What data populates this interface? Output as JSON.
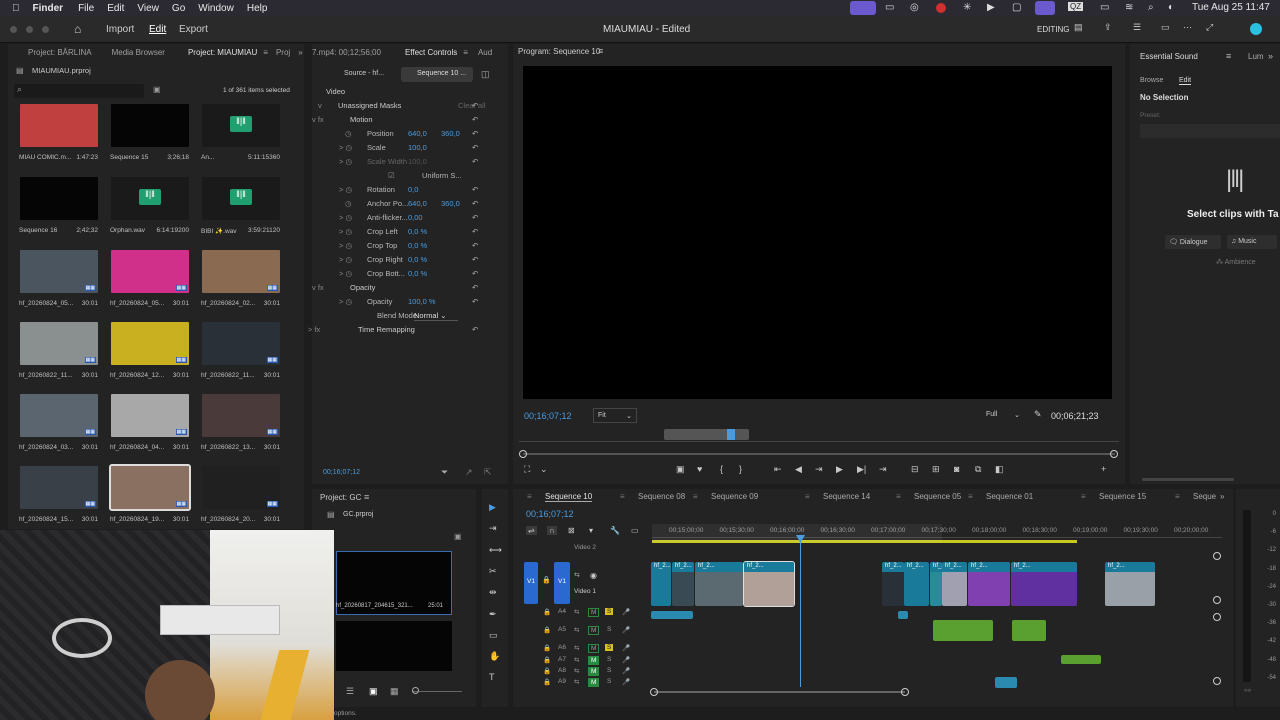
{
  "menubar": {
    "apple": "",
    "app": "Finder",
    "items": [
      "File",
      "Edit",
      "View",
      "Go",
      "Window",
      "Help"
    ],
    "clock": "Tue Aug 25  11:47"
  },
  "titlebar": {
    "home": "Home",
    "import": "Import",
    "edit": "Edit",
    "export": "Export",
    "title": "MIAUMIAU - Edited",
    "mode": "EDITING"
  },
  "project": {
    "tabs": [
      "Project: BĂRLINA",
      "Media Browser",
      "Project: MIAUMIAU",
      "Proj"
    ],
    "file": "MIAUMIAU.prproj",
    "selected": "1 of 361 items selected",
    "items": [
      {
        "name": "MIAU COMIC.m...",
        "dur": "1:47:23",
        "color": "#c04040"
      },
      {
        "name": "Sequence 15",
        "dur": "3;26;18",
        "color": "#050505"
      },
      {
        "name": "An...",
        "dur": "5:11:15360",
        "color": "#1a1a1a"
      },
      {
        "name": "Sequence 16",
        "dur": "2;42;32",
        "color": "#050505"
      },
      {
        "name": "Orphan.wav",
        "dur": "6:14:19200",
        "color": "#1a1a1a"
      },
      {
        "name": "BIBI ✨.wav",
        "dur": "3:59:21120",
        "color": "#1a1a1a"
      },
      {
        "name": "hf_20260824_05...",
        "dur": "30:01",
        "color": "#4a5560"
      },
      {
        "name": "hf_20260824_05...",
        "dur": "30:01",
        "color": "#d0308a"
      },
      {
        "name": "hf_20260824_02...",
        "dur": "30:01",
        "color": "#8a6a50"
      },
      {
        "name": "hf_20260822_11...",
        "dur": "30:01",
        "color": "#8a9090"
      },
      {
        "name": "hf_20260824_12...",
        "dur": "30:01",
        "color": "#c8b020"
      },
      {
        "name": "hf_20260822_11...",
        "dur": "30:01",
        "color": "#2a3038"
      },
      {
        "name": "hf_20260824_03...",
        "dur": "30:01",
        "color": "#5a6570"
      },
      {
        "name": "hf_20260824_04...",
        "dur": "30:01",
        "color": "#a8a8a8"
      },
      {
        "name": "hf_20260822_13...",
        "dur": "30:01",
        "color": "#4a3a3a"
      },
      {
        "name": "hf_20260824_15...",
        "dur": "30:01",
        "color": "#3a4048"
      },
      {
        "name": "hf_20260824_19...",
        "dur": "30:01",
        "color": "#8a7060"
      },
      {
        "name": "hf_20260824_20...",
        "dur": "30:01",
        "color": "#202020"
      }
    ]
  },
  "effect_controls": {
    "tabs": [
      "7.mp4: 00;12;56;00",
      "Effect Controls",
      "Aud"
    ],
    "source": "Source - hf...",
    "seq": "Sequence 10 ...",
    "video": "Video",
    "masks": "Unassigned Masks",
    "clear": "Clear all",
    "motion": "Motion",
    "position": "Position",
    "pos_x": "640,0",
    "pos_y": "360,0",
    "scale": "Scale",
    "scale_v": "100,0",
    "scale_w": "Scale Width",
    "scale_w_v": "100,0",
    "uniform": "Uniform S...",
    "rotation": "Rotation",
    "rotation_v": "0,0",
    "anchor": "Anchor Po...",
    "anc_x": "640,0",
    "anc_y": "360,0",
    "antiflicker": "Anti-flicker...",
    "antiflicker_v": "0,00",
    "crop_left": "Crop Left",
    "crop_left_v": "0,0 %",
    "crop_top": "Crop Top",
    "crop_top_v": "0,0 %",
    "crop_right": "Crop Right",
    "crop_right_v": "0,0 %",
    "crop_bottom": "Crop Bott...",
    "crop_bottom_v": "0,0 %",
    "opacity_grp": "Opacity",
    "opacity": "Opacity",
    "opacity_v": "100,0 %",
    "blend": "Blend Mode",
    "blend_v": "Normal",
    "remap": "Time Remapping",
    "time": "00;16;07;12"
  },
  "program": {
    "title": "Program: Sequence 10",
    "timecode": "00;16;07;12",
    "fit": "Fit",
    "full": "Full",
    "duration": "00;06;21;23"
  },
  "essential_sound": {
    "tabs": [
      "Essential Sound",
      "Lum"
    ],
    "browse": "Browse",
    "edit": "Edit",
    "no_sel": "No Selection",
    "preset": "Preset:",
    "select": "Select clips with Ta",
    "dialogue": "Dialogue",
    "music": "Music",
    "ambience": "Ambience"
  },
  "project_gc": {
    "title": "Project: GC",
    "file": "GC.prproj",
    "clip": "hf_20260817_204615_321...",
    "clip_dur": "25:01",
    "options": "options."
  },
  "timeline": {
    "tabs": [
      "Sequence 10",
      "Sequence 08",
      "Sequence 09",
      "Sequence 14",
      "Sequence 05",
      "Sequence 01",
      "Sequence 15",
      "Seque"
    ],
    "timecode": "00;16;07;12",
    "ruler": [
      "00;15;00;00",
      "00;15;30;00",
      "00;16;00;00",
      "00;16;30;00",
      "00;17;00;00",
      "00;17;30;00",
      "00;18;00;00",
      "00;18;30;00",
      "00;19;00;00",
      "00;19;30;00",
      "00;20;00;00"
    ],
    "video2": "Video 2",
    "video1": "Video 1",
    "v1": "V1",
    "audio_tracks": [
      "A4",
      "A5",
      "A6",
      "A7",
      "A8",
      "A9"
    ],
    "clip_label": "hf_2...",
    "meter": [
      "0",
      "-6",
      "-12",
      "-18",
      "-24",
      "-30",
      "-36",
      "-42",
      "-48",
      "-54"
    ]
  }
}
